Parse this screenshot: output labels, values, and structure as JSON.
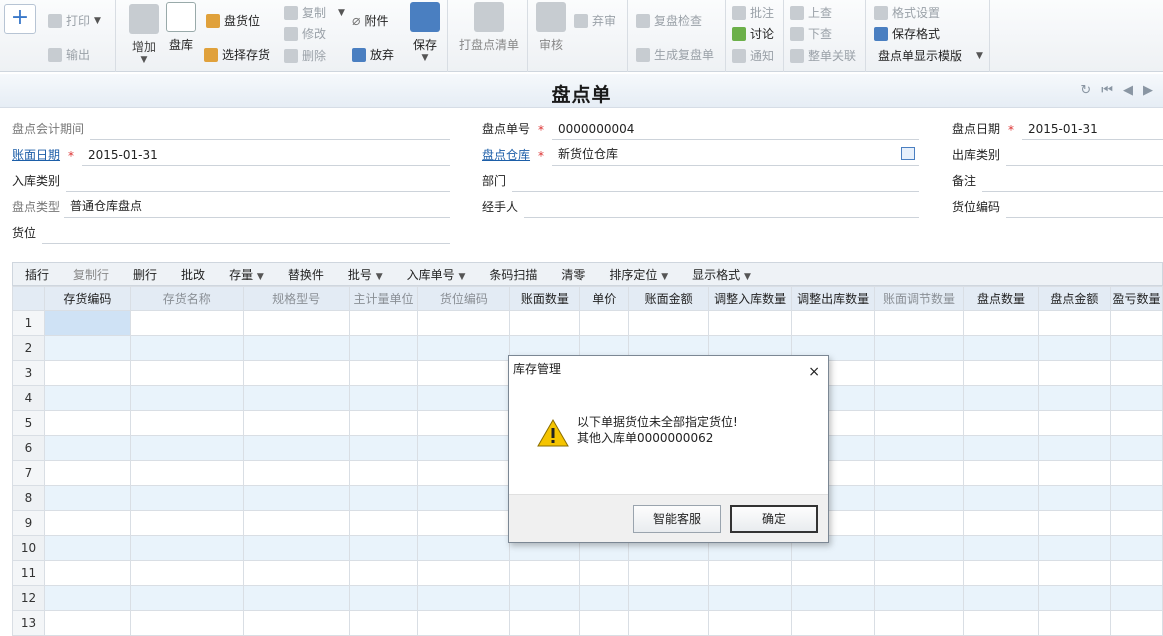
{
  "ribbon": {
    "print": "打印",
    "export": "输出",
    "add": "增加",
    "stocktake": "盘库",
    "stock_location": "盘货位",
    "select_inventory": "选择存货",
    "copy": "复制",
    "modify": "修改",
    "delete": "删除",
    "attachment": "附件",
    "discard": "放弃",
    "save": "保存",
    "print_list": "打盘点清单",
    "audit": "审核",
    "abandon_audit": "弃审",
    "recheck": "复盘检查",
    "gen_recheck": "生成复盘单",
    "annotate": "批注",
    "discuss": "讨论",
    "notify": "通知",
    "prev_query": "上查",
    "next_query": "下查",
    "whole_link": "整单关联",
    "format_settings": "格式设置",
    "save_format": "保存格式",
    "template": "盘点单显示模版"
  },
  "header": {
    "title": "盘点单"
  },
  "form": {
    "period_label": "盘点会计期间",
    "doc_no_label": "盘点单号",
    "doc_no": "0000000004",
    "date_label": "盘点日期",
    "date": "2015-01-31",
    "book_date_label": "账面日期",
    "book_date": "2015-01-31",
    "warehouse_label": "盘点仓库",
    "warehouse": "新货位仓库",
    "out_type_label": "出库类别",
    "in_type_label": "入库类别",
    "dept_label": "部门",
    "note_label": "备注",
    "type_label": "盘点类型",
    "type_value": "普通仓库盘点",
    "handler_label": "经手人",
    "loc_code_label": "货位编码",
    "loc_label": "货位"
  },
  "grid_toolbar": {
    "insert": "插行",
    "copy_row": "复制行",
    "delete_row": "删行",
    "batch": "批改",
    "stock_qty": "存量",
    "replace": "替换件",
    "lot": "批号",
    "in_doc": "入库单号",
    "barcode": "条码扫描",
    "clear_zero": "清零",
    "sort": "排序定位",
    "display": "显示格式"
  },
  "grid": {
    "columns": [
      "存货编码",
      "存货名称",
      "规格型号",
      "主计量单位",
      "货位编码",
      "账面数量",
      "单价",
      "账面金额",
      "调整入库数量",
      "调整出库数量",
      "账面调节数量",
      "盘点数量",
      "盘点金额",
      "盈亏数量"
    ],
    "rows": [
      "1",
      "2",
      "3",
      "4",
      "5",
      "6",
      "7",
      "8",
      "9",
      "10",
      "11",
      "12",
      "13"
    ]
  },
  "dialog": {
    "title": "库存管理",
    "line1": "以下单据货位未全部指定货位!",
    "line2": "其他入库单0000000062",
    "btn_service": "智能客服",
    "btn_ok": "确定"
  }
}
